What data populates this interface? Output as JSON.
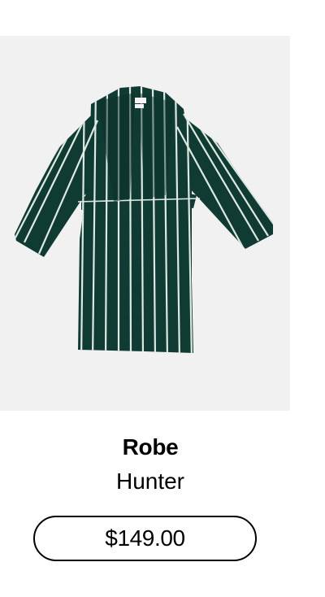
{
  "product": {
    "name": "Robe",
    "color": "Hunter",
    "price": "$149.00",
    "image_icon": "striped-robe-image",
    "robe_color": "#0f3b33",
    "stripe_color": "#dfe9e4"
  }
}
